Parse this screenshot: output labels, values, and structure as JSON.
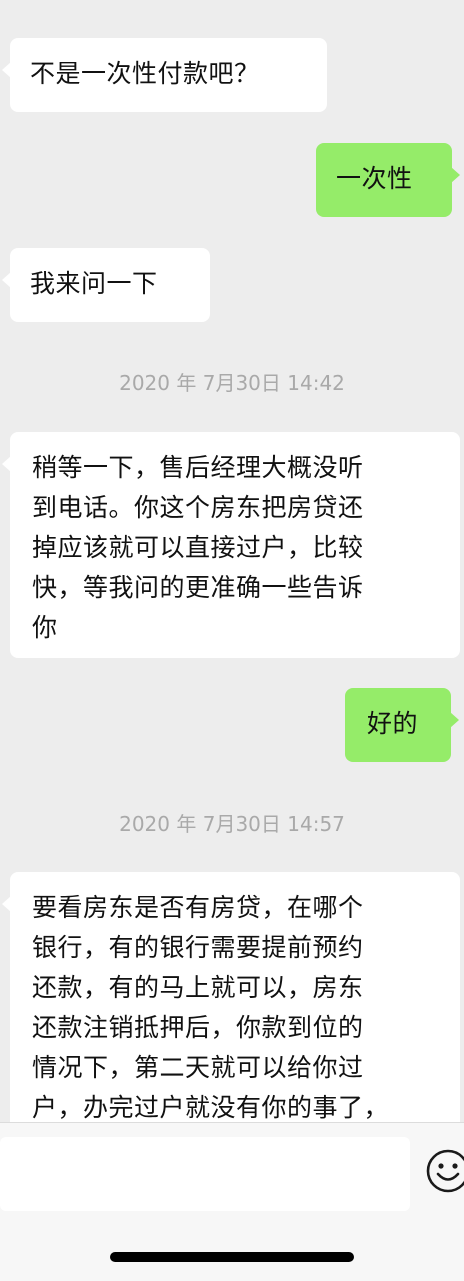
{
  "messages": [
    {
      "side": "in",
      "text": "不是一次性付款吧？"
    },
    {
      "side": "out",
      "text": "一次性"
    },
    {
      "side": "in",
      "text": "我来问一下"
    },
    {
      "timestamp": "2020 年 7月30日 14:42"
    },
    {
      "side": "in",
      "lines": [
        "稍等一下，售后经理大概没听",
        "到电话。你这个房东把房贷还",
        "掉应该就可以直接过户，比较",
        "快，等我问的更准确一些告诉",
        "你"
      ]
    },
    {
      "side": "out",
      "text": "好的"
    },
    {
      "timestamp": "2020 年 7月30日 14:57"
    },
    {
      "side": "in",
      "lines": [
        "要看房东是否有房贷，在哪个",
        "银行，有的银行需要提前预约",
        "还款，有的马上就可以，房东",
        "还款注销抵押后，你款到位的",
        "情况下，第二天就可以给你过",
        "户，办完过户就没有你的事了，"
      ]
    }
  ],
  "input_bar": {
    "placeholder": "",
    "emoji_icon": "smiley-face-icon"
  }
}
